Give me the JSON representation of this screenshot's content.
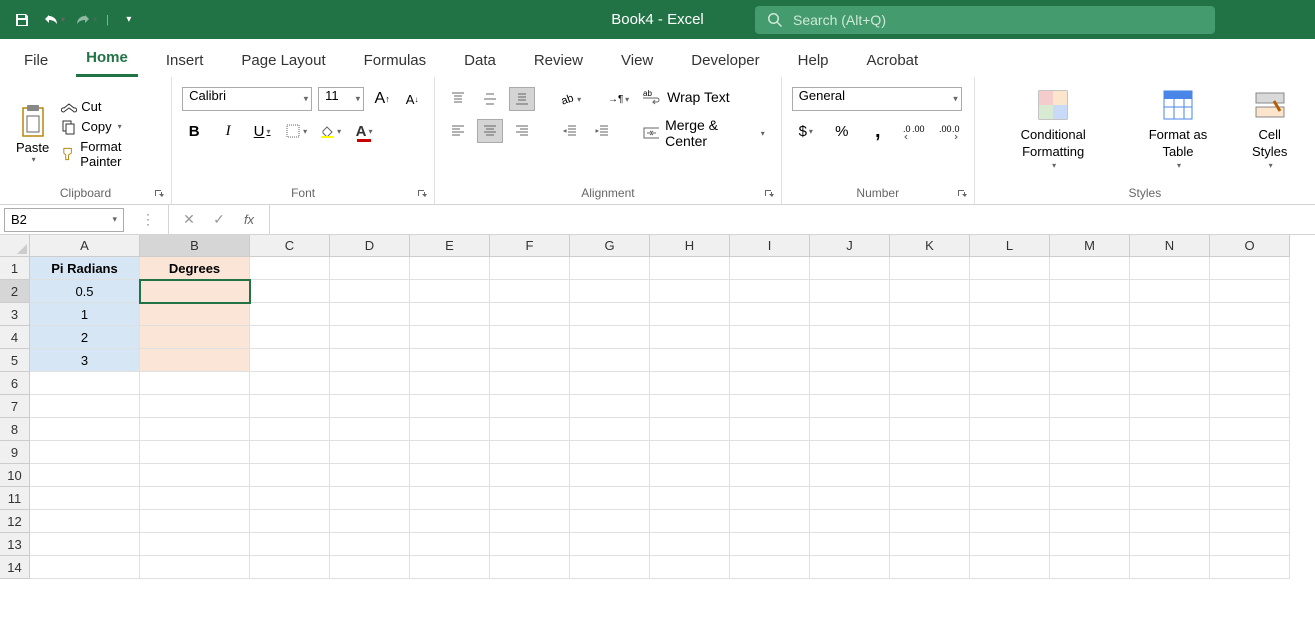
{
  "title": "Book4  -  Excel",
  "search": {
    "placeholder": "Search (Alt+Q)"
  },
  "tabs": [
    "File",
    "Home",
    "Insert",
    "Page Layout",
    "Formulas",
    "Data",
    "Review",
    "View",
    "Developer",
    "Help",
    "Acrobat"
  ],
  "activeTab": "Home",
  "clipboard": {
    "paste": "Paste",
    "cut": "Cut",
    "copy": "Copy",
    "formatPainter": "Format Painter",
    "label": "Clipboard"
  },
  "font": {
    "name": "Calibri",
    "size": "11",
    "label": "Font"
  },
  "alignment": {
    "wrapText": "Wrap Text",
    "mergeCenter": "Merge & Center",
    "label": "Alignment"
  },
  "number": {
    "format": "General",
    "label": "Number"
  },
  "styles": {
    "conditional": "Conditional Formatting",
    "formatTable": "Format as Table",
    "cellStyles": "Cell Styles",
    "label": "Styles"
  },
  "nameBox": "B2",
  "formula": "",
  "columns": [
    "A",
    "B",
    "C",
    "D",
    "E",
    "F",
    "G",
    "H",
    "I",
    "J",
    "K",
    "L",
    "M",
    "N",
    "O"
  ],
  "rows": [
    "1",
    "2",
    "3",
    "4",
    "5",
    "6",
    "7",
    "8",
    "9",
    "10",
    "11",
    "12",
    "13",
    "14"
  ],
  "selectedCell": "B2",
  "cells": {
    "A1": "Pi Radians",
    "B1": "Degrees",
    "A2": "0.5",
    "A3": "1",
    "A4": "2",
    "A5": "3"
  },
  "chart_data": null
}
